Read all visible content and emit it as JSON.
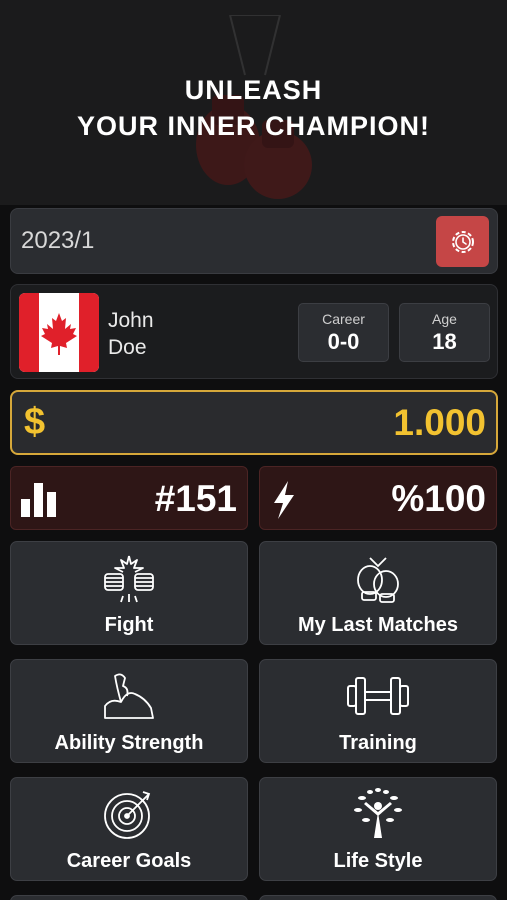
{
  "hero": {
    "line1": "UNLEASH",
    "line2": "YOUR INNER CHAMPION!"
  },
  "date": {
    "value": "2023/1",
    "settings_icon": "gear-icon"
  },
  "profile": {
    "first_name": "John",
    "last_name": "Doe",
    "flag": "canada-flag",
    "career_label": "Career",
    "career_value": "0-0",
    "age_label": "Age",
    "age_value": "18"
  },
  "money": {
    "symbol": "$",
    "amount": "1.000"
  },
  "rank": {
    "value": "#151",
    "icon": "bar-chart-icon"
  },
  "energy": {
    "value": "%100",
    "icon": "lightning-icon"
  },
  "tiles": [
    {
      "label": "Fight",
      "icon": "fist-bump-icon"
    },
    {
      "label": "My Last Matches",
      "icon": "boxing-gloves-icon"
    },
    {
      "label": "Ability Strength",
      "icon": "flexed-bicep-icon"
    },
    {
      "label": "Training",
      "icon": "dumbbell-icon"
    },
    {
      "label": "Career Goals",
      "icon": "target-icon"
    },
    {
      "label": "Life Style",
      "icon": "tree-person-icon"
    }
  ],
  "colors": {
    "accent_red": "#c54646",
    "gold": "#f2c230",
    "panel": "#2b2d31",
    "dark_red": "#2e1616"
  }
}
